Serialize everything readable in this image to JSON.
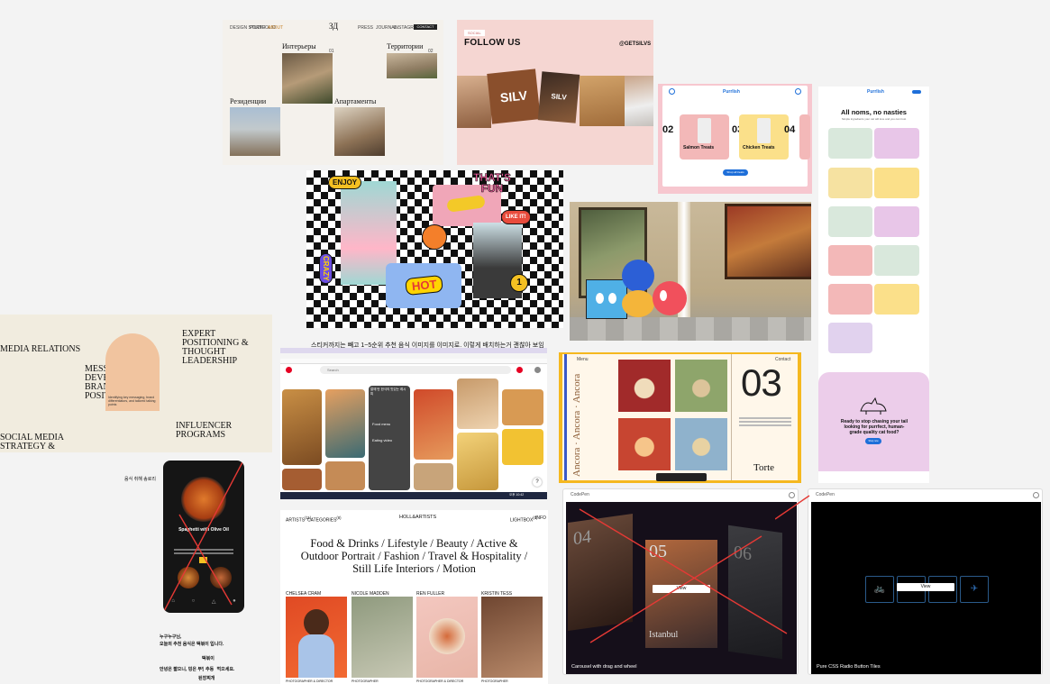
{
  "colors": {
    "canvas_bg": "#f3f3f3",
    "silv_bg": "#f5d6d2",
    "purrlia_bg": "#f7c7cf",
    "accent_red": "#e53935",
    "accent_yellow": "#f6b21b",
    "pinterest_red": "#e60023"
  },
  "architecture": {
    "nav_links": [
      "DESIGN STUDIO",
      "PORTFOLIO",
      "ABOUT"
    ],
    "nav_right": [
      "PRESS",
      "JOURNAL",
      "INSTAGRAM"
    ],
    "logo": "ЗД",
    "cta": "CONTACT",
    "labels": [
      "Интерьеры",
      "Территории",
      "Резиденции",
      "Апартаменты"
    ],
    "counts": [
      "01",
      "02"
    ]
  },
  "silv": {
    "tag": "SOCIAL",
    "heading": "FOLLOW US",
    "handle": "@GETSILVS",
    "brand": "SILV"
  },
  "purrlia": {
    "logo": "Purrlish",
    "numbers": [
      "02",
      "03",
      "04"
    ],
    "products": [
      "Salmon Treats",
      "Chicken Treats"
    ],
    "cta": "Shop all treats"
  },
  "all_noms": {
    "logo": "Purrlish",
    "title": "All noms, no nasties",
    "subtitle": "Simple ingredients your cat will love and you can trust",
    "cta_text": "Ready to stop chasing your tail looking for purrfect, human-grade quality cat food?",
    "cta_button": "Shop now"
  },
  "stickers": {
    "enjoy": "ENJOY",
    "thats_fun": "THAT'S FUN",
    "like_it": "LIKE IT!",
    "hot": "HOT",
    "crazy": "CRAZY",
    "one": "1"
  },
  "agency": {
    "items": [
      "MEDIA RELATIONS",
      "MESSAGE DEVELOPMENT BRAND POSITIONING",
      "EXPERT POSITIONING & THOUGHT LEADERSHIP",
      "SOCIAL MEDIA STRATEGY &",
      "INFLUENCER PROGRAMS"
    ],
    "card_note": "Identifying key messaging, brand differentiators, and tailored talking points"
  },
  "food_app": {
    "annotation": "음식 취해 송로리",
    "title": "Spaghetti with Olive Oil",
    "note_lines": [
      "누구누구님,",
      "오늘의 추천 음식은 떡볶이 입니다.",
      "떡볶이",
      "안녕은 짧으니, 덩은 부담 부터 먹으세요.",
      "된장찌개"
    ],
    "note_word": "추동"
  },
  "pinterest": {
    "caption": "스티커까지는 빼고 1~5순위 추천 음식 이미지를 이미지로. 이렇게 배치하는거 괜찮아 보임",
    "search_placeholder": "Search",
    "overlay_labels": [
      "알에 탄 한식의 맛있는 레시피",
      "Food menu",
      "Eating video"
    ],
    "time": "오후 10:42",
    "help": "?"
  },
  "ancora": {
    "vertical": "Ancora · Ancora · Ancora",
    "number": "03",
    "word": "Torte",
    "nav_left": "Menu",
    "nav_right": "Contact"
  },
  "hollisartists": {
    "nav": [
      "ARTISTS",
      "CATEGORIES",
      "LIGHTBOX",
      "INFO"
    ],
    "nav_sup": [
      "(11)",
      "(8)",
      "(0)"
    ],
    "brand": "HOLL&ARTISTS",
    "headline": "Food & Drinks / Lifestyle / Beauty / Active & Outdoor Portrait / Fashion / Travel & Hospitality / Still Life Interiors / Motion",
    "artists": [
      "CHELSEA CRAM",
      "NICOLE MADDEN",
      "REN FULLER",
      "KRISTIN TESS"
    ],
    "roles": [
      "PHOTOGRAPHER & DIRECTOR",
      "PHOTOGRAPHER",
      "PHOTOGRAPHER & DIRECTOR",
      "PHOTOGRAPHER"
    ]
  },
  "codepen_carousel": {
    "header": "CodePen",
    "numbers": [
      "04",
      "05",
      "06"
    ],
    "city": "Istanbul",
    "view": "View",
    "caption": "Carousel with drag and wheel"
  },
  "codepen_radio": {
    "header": "CodePen",
    "view": "View",
    "caption": "Pure CSS Radio Button Tiles",
    "tile_icons": [
      "bicycle-icon",
      "car-icon",
      "plane-icon"
    ]
  }
}
